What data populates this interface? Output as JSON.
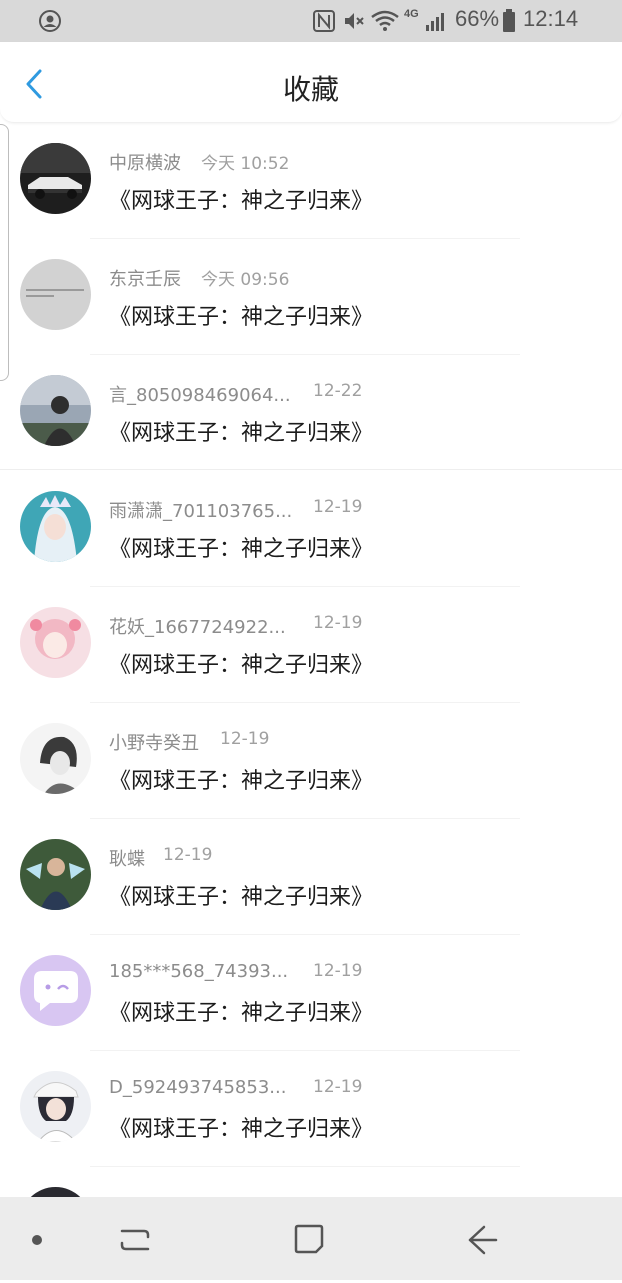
{
  "status_bar": {
    "battery_percent": "66%",
    "time": "12:14",
    "network": "4G",
    "icons": [
      "account-circle-icon",
      "nfc-icon",
      "mute-icon",
      "wifi-icon",
      "signal-icon",
      "battery-icon"
    ]
  },
  "header": {
    "back_icon": "chevron-left-icon",
    "title": "收藏"
  },
  "list": [
    {
      "name": "中原横波",
      "time": "今天 10:52",
      "title": "《网球王子：神之子归来》",
      "avatar": "dark-car-photo"
    },
    {
      "name": "东京壬辰",
      "time": "今天 09:56",
      "title": "《网球王子：神之子归来》",
      "avatar": "gray-text-image"
    },
    {
      "name": "言_805098469064...",
      "time": "12-22",
      "title": "《网球王子：神之子归来》",
      "avatar": "person-at-dusk"
    },
    {
      "name": "雨潇潇_701103765...",
      "time": "12-19",
      "title": "《网球王子：神之子归来》",
      "avatar": "anime-white-hair"
    },
    {
      "name": "花妖_1667724922...",
      "time": "12-19",
      "title": "《网球王子：神之子归来》",
      "avatar": "anime-pink-girl"
    },
    {
      "name": "小野寺癸丑",
      "time": "12-19",
      "title": "《网球王子：神之子归来》",
      "avatar": "bw-sketch-person"
    },
    {
      "name": "耿蝶",
      "time": "12-19",
      "title": "《网球王子：神之子归来》",
      "avatar": "boy-with-wings"
    },
    {
      "name": "185***568_74393...",
      "time": "12-19",
      "title": "《网球王子：神之子归来》",
      "avatar": "purple-chat-bubble"
    },
    {
      "name": "D_592493745853...",
      "time": "12-19",
      "title": "《网球王子：神之子归来》",
      "avatar": "anime-boy-cap"
    }
  ],
  "nav_bar": {
    "icons": [
      "dot-icon",
      "recent-apps-icon",
      "home-icon",
      "back-arrow-icon"
    ]
  },
  "colors": {
    "accent": "#2f9ae0",
    "status_bar_bg": "#d9d9d9",
    "nav_bar_bg": "#ececec"
  }
}
